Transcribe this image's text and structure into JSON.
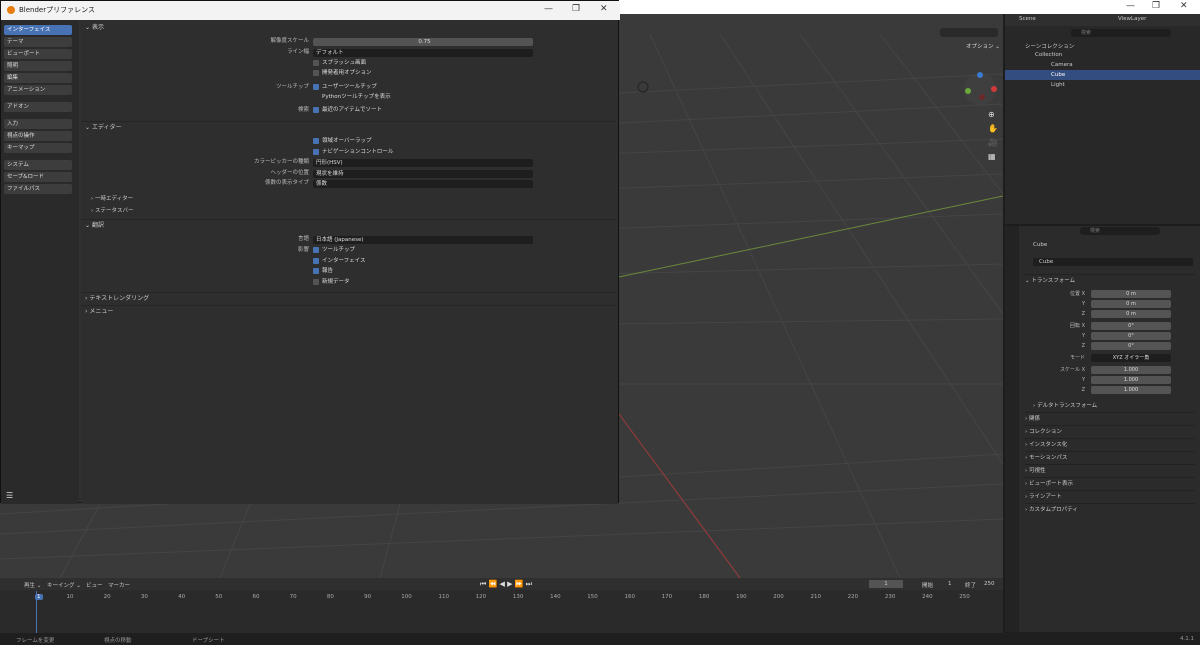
{
  "main_window": {
    "minimize": "—",
    "maximize": "❐",
    "close": "✕"
  },
  "header": {
    "scene_label": "Scene",
    "view_layer_label": "ViewLayer",
    "options_label": "オプション ⌄"
  },
  "prefs": {
    "title": "Blenderプリファレンス",
    "nav": [
      "インターフェイス",
      "テーマ",
      "ビューポート",
      "照明",
      "編集",
      "アニメーション",
      "アドオン",
      "入力",
      "視点の操作",
      "キーマップ",
      "システム",
      "セーブ&ロード",
      "ファイルパス"
    ],
    "active_nav": "インターフェイス",
    "display_section": "表示",
    "resolution_scale_label": "解像度スケール",
    "resolution_scale_value": "0.75",
    "line_width_label": "ライン幅",
    "line_width_value": "デフォルト",
    "splash_label": "スプラッシュ画面",
    "dev_options_label": "開発者用オプション",
    "tooltips_label": "ツールチップ",
    "user_tooltips_label": "ユーザーツールチップ",
    "python_tooltips_label": "Pythonツールチップを表示",
    "search_label": "検索",
    "sort_recent_label": "最近のアイテムでソート",
    "editors_section": "エディター",
    "region_overlap_label": "領域オーバーラップ",
    "nav_controls_label": "ナビゲーションコントロール",
    "color_picker_label": "カラーピッカーの種類",
    "color_picker_value": "円形(HSV)",
    "header_pos_label": "ヘッダーの位置",
    "header_pos_value": "現状を維持",
    "factor_display_label": "係数の表示タイプ",
    "factor_display_value": "係数",
    "temp_editors_label": "一時エディター",
    "status_bar_label": "ステータスバー",
    "translation_section": "翻訳",
    "language_label": "言語",
    "language_value": "日本語 (Japanese)",
    "affect_label": "影響",
    "tr_tooltips_label": "ツールチップ",
    "tr_interface_label": "インターフェイス",
    "tr_reports_label": "報告",
    "tr_new_data_label": "新規データ",
    "text_rendering_section": "テキストレンダリング",
    "menus_section": "メニュー"
  },
  "outliner": {
    "search_placeholder": "検索",
    "scene_collection": "シーンコレクション",
    "collection": "Collection",
    "items": [
      {
        "name": "Camera"
      },
      {
        "name": "Cube"
      },
      {
        "name": "Light"
      }
    ]
  },
  "properties": {
    "search_placeholder": "検索",
    "object_name": "Cube",
    "object_field": "Cube",
    "transform_section": "トランスフォーム",
    "loc_x_label": "位置 X",
    "loc_x": "0 m",
    "loc_y_label": "Y",
    "loc_y": "0 m",
    "loc_z_label": "Z",
    "loc_z": "0 m",
    "rot_x_label": "回転 X",
    "rot_x": "0°",
    "rot_y_label": "Y",
    "rot_y": "0°",
    "rot_z_label": "Z",
    "rot_z": "0°",
    "mode_label": "モード",
    "mode_value": "XYZ オイラー角",
    "scale_x_label": "スケール X",
    "scale_x": "1.000",
    "scale_y_label": "Y",
    "scale_y": "1.000",
    "scale_z_label": "Z",
    "scale_z": "1.000",
    "delta_transform": "デルタトランスフォーム",
    "sections": [
      "関係",
      "コレクション",
      "インスタンス化",
      "モーションパス",
      "可視性",
      "ビューポート表示",
      "ラインアート",
      "カスタムプロパティ"
    ]
  },
  "timeline": {
    "playback": "再生 ⌄",
    "keying": "キーイング ⌄",
    "view": "ビュー",
    "marker": "マーカー",
    "current_frame": "1",
    "start_label": "開始",
    "start_value": "1",
    "end_label": "終了",
    "end_value": "250",
    "ticks": [
      "1",
      "10",
      "20",
      "30",
      "40",
      "50",
      "60",
      "70",
      "80",
      "90",
      "100",
      "110",
      "120",
      "130",
      "140",
      "150",
      "160",
      "170",
      "180",
      "190",
      "200",
      "210",
      "220",
      "230",
      "240",
      "250"
    ]
  },
  "status": {
    "frame_change": "フレームを変更",
    "view_move": "視点の移動",
    "dopesheet": "ドープシート",
    "version": "4.1.1"
  }
}
